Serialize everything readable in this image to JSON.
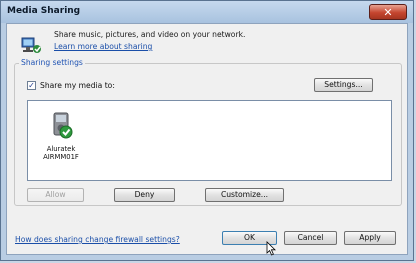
{
  "window": {
    "title": "Media Sharing",
    "close_glyph": "✕"
  },
  "header": {
    "description": "Share music, pictures, and video on your network.",
    "learn_more_link": "Learn more about sharing"
  },
  "sharing_settings": {
    "group_label": "Sharing settings",
    "share_checkbox_label": "Share my media to:",
    "share_checked": true,
    "settings_button": "Settings...",
    "devices": [
      {
        "name_line1": "Aluratek",
        "name_line2": "AIRMM01F"
      }
    ],
    "allow_button": "Allow",
    "deny_button": "Deny",
    "customize_button": "Customize..."
  },
  "footer": {
    "firewall_link": "How does sharing change firewall settings?",
    "ok_button": "OK",
    "cancel_button": "Cancel",
    "apply_button": "Apply"
  },
  "icons": {
    "header": "media-sharing-network-icon",
    "device": "media-device-icon",
    "cursor": "mouse-pointer-icon"
  }
}
